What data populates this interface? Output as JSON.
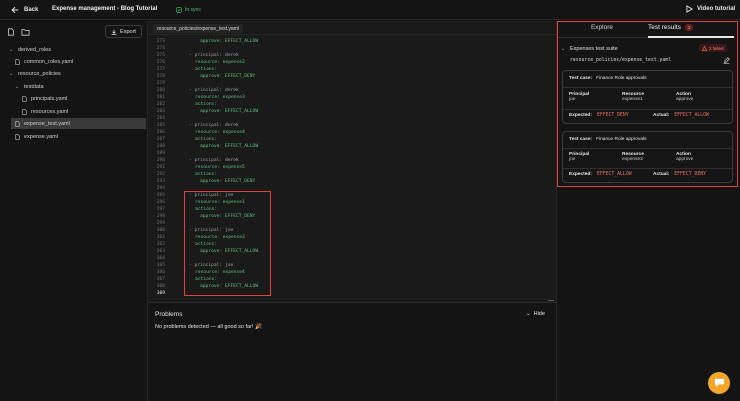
{
  "header": {
    "back_label": "Back",
    "project_title": "Expense management - Blog Tutorial",
    "sync_status": "In sync",
    "video_label": "Video tutorial"
  },
  "sidebar": {
    "export_label": "Export",
    "tree": [
      {
        "label": "derived_roles",
        "type": "folder"
      },
      {
        "label": "common_roles.yaml",
        "type": "file"
      },
      {
        "label": "resource_policies",
        "type": "folder"
      },
      {
        "label": "testdata",
        "type": "folder"
      },
      {
        "label": "principals.yaml",
        "type": "file"
      },
      {
        "label": "resources.yaml",
        "type": "file"
      },
      {
        "label": "expense_test.yaml",
        "type": "file",
        "active": true
      },
      {
        "label": "expense.yaml",
        "type": "file"
      }
    ]
  },
  "editor": {
    "tab_label": "resource_policies/expense_test.yaml",
    "lines": [
      {
        "n": "273",
        "text": "approve: EFFECT_ALLOW"
      },
      {
        "n": "274",
        "text": ""
      },
      {
        "n": "275",
        "text": "- principal: derek"
      },
      {
        "n": "276",
        "text": "resource: expense2"
      },
      {
        "n": "277",
        "text": "actions:"
      },
      {
        "n": "278",
        "text": "approve: EFFECT_DENY"
      },
      {
        "n": "279",
        "text": ""
      },
      {
        "n": "280",
        "text": "- principal: derek"
      },
      {
        "n": "281",
        "text": "resource: expense3"
      },
      {
        "n": "282",
        "text": "actions:"
      },
      {
        "n": "283",
        "text": "approve: EFFECT_ALLOW"
      },
      {
        "n": "284",
        "text": ""
      },
      {
        "n": "285",
        "text": "- principal: derek"
      },
      {
        "n": "286",
        "text": "resource: expense4"
      },
      {
        "n": "287",
        "text": "actions:"
      },
      {
        "n": "288",
        "text": "approve: EFFECT_ALLOW"
      },
      {
        "n": "289",
        "text": ""
      },
      {
        "n": "290",
        "text": "- principal: derek"
      },
      {
        "n": "291",
        "text": "resource: expense5"
      },
      {
        "n": "292",
        "text": "actions:"
      },
      {
        "n": "293",
        "text": "approve: EFFECT_DENY"
      },
      {
        "n": "294",
        "text": ""
      },
      {
        "n": "295",
        "text": "- principal: joe"
      },
      {
        "n": "296",
        "text": "resource: expense1"
      },
      {
        "n": "297",
        "text": "actions:"
      },
      {
        "n": "298",
        "text": "approve: EFFECT_DENY"
      },
      {
        "n": "299",
        "text": ""
      },
      {
        "n": "300",
        "text": "- principal: joe"
      },
      {
        "n": "301",
        "text": "resource: expense3"
      },
      {
        "n": "302",
        "text": "actions:"
      },
      {
        "n": "303",
        "text": "approve: EFFECT_ALLOW"
      },
      {
        "n": "304",
        "text": ""
      },
      {
        "n": "305",
        "text": "- principal: joe"
      },
      {
        "n": "306",
        "text": "resource: expense4"
      },
      {
        "n": "307",
        "text": "actions:"
      },
      {
        "n": "308",
        "text": "approve: EFFECT_ALLOW"
      },
      {
        "n": "309",
        "text": ""
      }
    ]
  },
  "problems": {
    "title": "Problems",
    "hide_label": "Hide",
    "message": "No problems detected — all good so far! 🎉"
  },
  "right_panel": {
    "tab_explore": "Explore",
    "tab_results": "Test results",
    "results_count": "2",
    "suite_name": "Expenses test suite",
    "failed_label": "2 failed",
    "suite_file": "resource_policies/expense_test.yaml",
    "cards": [
      {
        "test_case_label": "Test case:",
        "test_case": "Finance Role approvals",
        "principal_h": "Principal",
        "principal": "joe",
        "resource_h": "Resource",
        "resource": "expense1",
        "action_h": "Action",
        "action": "approve",
        "expected_label": "Expected:",
        "expected": "EFFECT_DENY",
        "actual_label": "Actual:",
        "actual": "EFFECT_ALLOW"
      },
      {
        "test_case_label": "Test case:",
        "test_case": "Finance Role approvals",
        "principal_h": "Principal",
        "principal": "joe",
        "resource_h": "Resource",
        "resource": "expense3",
        "action_h": "Action",
        "action": "approve",
        "expected_label": "Expected:",
        "expected": "EFFECT_ALLOW",
        "actual_label": "Actual:",
        "actual": "EFFECT_DENY"
      }
    ]
  },
  "colors": {
    "accent_red": "#e0443c",
    "sync_green": "#4ec26b",
    "chat_orange": "#f2a62a"
  }
}
